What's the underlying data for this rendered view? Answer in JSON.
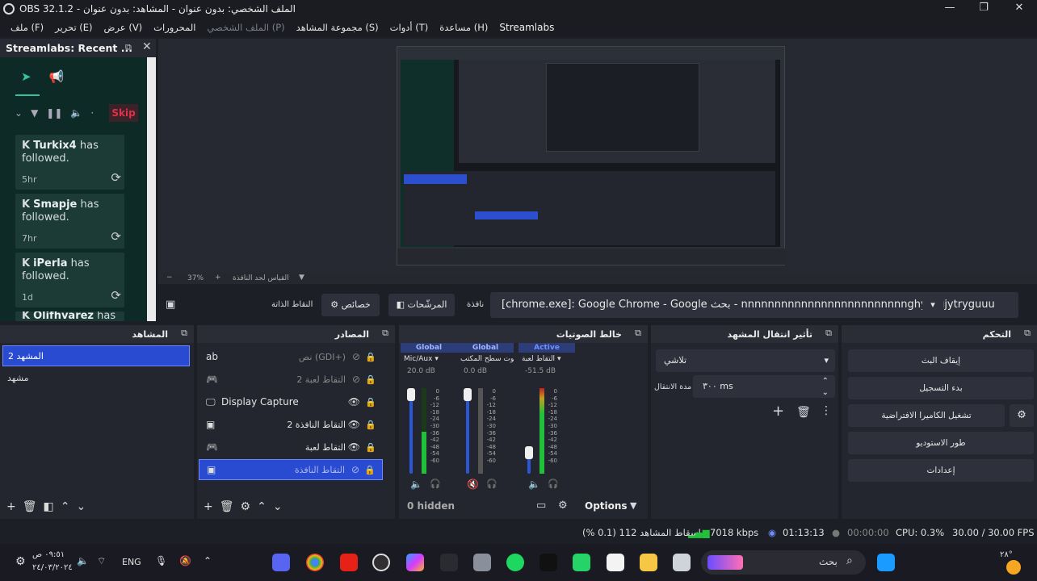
{
  "window": {
    "title": "OBS 32.1.2 - الملف الشخصي: بدون عنوان - المشاهد: بدون عنوان",
    "min": "—",
    "max": "❐",
    "close": "✕"
  },
  "menu": [
    {
      "label": "ملف (F)",
      "disabled": false
    },
    {
      "label": "تحرير (E)",
      "disabled": false
    },
    {
      "label": "عرض (V)",
      "disabled": false
    },
    {
      "label": "المحرورات",
      "disabled": false
    },
    {
      "label": "الملف الشخصي (P)",
      "disabled": true
    },
    {
      "label": "مجموعة المشاهد (S)",
      "disabled": false
    },
    {
      "label": "أدوات (T)",
      "disabled": false
    },
    {
      "label": "مساعدة (H)",
      "disabled": false
    },
    {
      "label": "Streamlabs",
      "disabled": false
    }
  ],
  "streamlabs": {
    "title": "Streamlabs: Recent ...",
    "skip": "Skip",
    "alerts": [
      {
        "name": "Turkix4",
        "action": "has followed.",
        "time": "5hr"
      },
      {
        "name": "Smapje",
        "action": "has followed.",
        "time": "7hr"
      },
      {
        "name": "iPerla",
        "action": "has followed.",
        "time": "1d"
      },
      {
        "name": "Olifhvarez",
        "action": "has",
        "time": ""
      }
    ]
  },
  "preview": {
    "zoom": "37%",
    "fit_label": "القياس لحد النافذة"
  },
  "source_toolbar": {
    "source_label": "النقاط الذاتة",
    "properties": "خصائص",
    "filters": "المرشّحات",
    "window_label": "نافذة",
    "window_value": "[chrome.exe]: Google Chrome - Google بحث - nnnnnnnnnnnnnnnnnnnnnnnnnghytggjytryguuu"
  },
  "scenes": {
    "title": "المشاهد",
    "items": [
      {
        "label": "المشهد 2",
        "selected": true
      },
      {
        "label": "مشهد",
        "selected": false
      }
    ]
  },
  "sources": {
    "title": "المصادر",
    "items": [
      {
        "icon": "ab",
        "label": "نص (GDI+)",
        "visible": false,
        "selected": false,
        "dim": true
      },
      {
        "icon": "🎮",
        "label": "التقاط لعبة 2",
        "visible": false,
        "selected": false,
        "dim": true
      },
      {
        "icon": "🖵",
        "label": "Display Capture",
        "visible": true,
        "selected": false,
        "dim": false
      },
      {
        "icon": "▣",
        "label": "التقاط النافذة 2",
        "visible": true,
        "selected": false,
        "dim": false
      },
      {
        "icon": "🎮",
        "label": "التقاط لعبة",
        "visible": true,
        "selected": false,
        "dim": false
      },
      {
        "icon": "▣",
        "label": "التقاط النافذة",
        "visible": false,
        "selected": true,
        "dim": true
      }
    ]
  },
  "mixer": {
    "title": "خالط الصوتيات",
    "channels": [
      {
        "tag": "Global",
        "name": "Mic/Aux",
        "db": "20.0 dB",
        "level": 0.55,
        "fader": 0.92,
        "muted": false
      },
      {
        "tag": "Global",
        "name": "صوت سطح المكتب",
        "db": "0.0 dB",
        "level": 0.0,
        "fader": 0.92,
        "muted": true
      },
      {
        "tag": "Active",
        "name": "التقاط لعبة",
        "db": "-51.5 dB",
        "level": 0.85,
        "fader": 0.22,
        "muted": false
      }
    ],
    "scale": [
      "0",
      "-6",
      "-12",
      "-18",
      "-24",
      "-30",
      "-36",
      "-42",
      "-48",
      "-54",
      "-60"
    ],
    "hidden": "0 hidden",
    "options": "Options"
  },
  "transitions": {
    "title": "تأثير انتقال المشهد",
    "type": "تلاشي",
    "duration_label": "مدة الانتقال",
    "duration": "٣٠٠ ms"
  },
  "controls": {
    "title": "التحكم",
    "buttons": [
      "إيقاف البث",
      "بدء التسجيل",
      "تشغيل الكاميرا الافتراضية",
      "طور الاستوديو",
      "إعدادات"
    ]
  },
  "status": {
    "dropped": "إسقاط المشاهد 112 (0.1 %)",
    "bitrate": "7018 kbps",
    "stream_time": "01:13:13",
    "rec_time": "00:00:00",
    "cpu": "CPU: 0.3%",
    "fps": "30.00 / 30.00 FPS"
  },
  "taskbar": {
    "time": "٠٩:٥١ ص",
    "date": "٢٤/٠٣/٢٠٢٤",
    "lang": "ENG",
    "search": "بحث",
    "temp": "٢٨°"
  }
}
